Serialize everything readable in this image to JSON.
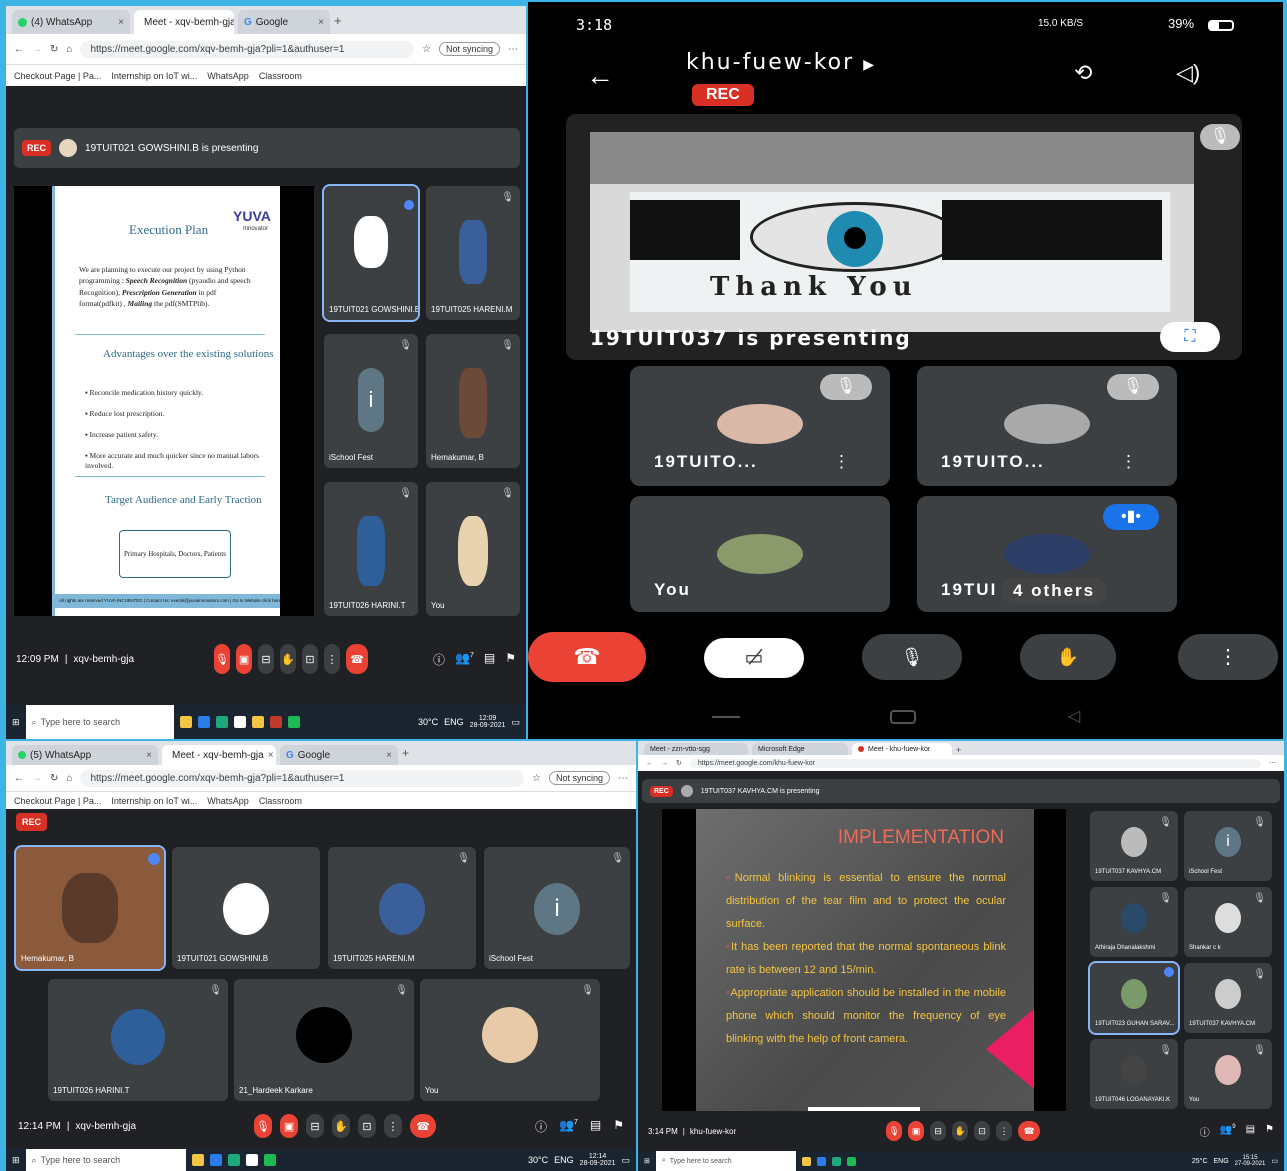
{
  "q1": {
    "tabs": [
      {
        "label": "(4) WhatsApp"
      },
      {
        "label": "Meet - xqv-bemh-gja"
      },
      {
        "label": "Google"
      }
    ],
    "new_tab": "+",
    "url": "https://meet.google.com/xqv-bemh-gja?pli=1&authuser=1",
    "sync": "Not syncing",
    "bookmarks": [
      "Checkout Page | Pa...",
      "Internship on IoT wi...",
      "WhatsApp",
      "Classroom"
    ],
    "rec": "REC",
    "presenting": "19TUIT021 GOWSHINI.B is presenting",
    "slide": {
      "title1": "Execution Plan",
      "logo": "YUVA",
      "logo_sub": "Innovator",
      "para_a": "We are planning to execute our project by using Python programming : ",
      "para_b": "Speech Recognition",
      "para_c": " (pyaudio and speech Recognition), ",
      "para_d": "Prescription Generation",
      "para_e": " in pdf format(pdfkit) , ",
      "para_f": "Mailing",
      "para_g": " the pdf(SMTPlib).",
      "title2": "Advantages over the existing solutions",
      "bullets": [
        "Reconcile medication history quickly.",
        "Reduce lost prescription.",
        "Increase patient safety.",
        "More accurate and much quicker since no manual labors involved."
      ],
      "title3": "Target Audience and Early Traction",
      "box": "Primary Hospitals, Doctors, Patients",
      "footer": "All rights are reserved YUVA INCUBATED | Contact Us: events@yuvainnovators.com | Go to Website click here"
    },
    "tiles": [
      {
        "name": "19TUIT021 GOWSHINI.B"
      },
      {
        "name": "19TUIT025 HARENI.M"
      },
      {
        "name": "iSchool Fest",
        "initial": "i"
      },
      {
        "name": "Hemakumar, B"
      },
      {
        "name": "19TUIT026 HARINI.T"
      },
      {
        "name": "You"
      }
    ],
    "time": "12:09 PM",
    "code": "xqv-bemh-gja",
    "people": "7",
    "search": "Type here to search",
    "weather": "30°C",
    "lang": "ENG",
    "clock": "12:09",
    "date": "28-09-2021"
  },
  "q2": {
    "time": "3:18",
    "status": "39%",
    "net": "15.0 KB/S",
    "room": "khu-fuew-kor",
    "rec": "REC",
    "shared_text": "Thank You",
    "presenting": "19TUIT037 is presenting",
    "tiles": [
      {
        "name": "19TUITO..."
      },
      {
        "name": "19TUITO..."
      },
      {
        "name": "You"
      },
      {
        "name": "19TUI",
        "extra": "4 others"
      }
    ]
  },
  "q3": {
    "tabs": [
      {
        "label": "(5) WhatsApp"
      },
      {
        "label": "Meet - xqv-bemh-gja"
      },
      {
        "label": "Google"
      }
    ],
    "new_tab": "+",
    "url": "https://meet.google.com/xqv-bemh-gja?pli=1&authuser=1",
    "sync": "Not syncing",
    "bookmarks": [
      "Checkout Page | Pa...",
      "Internship on IoT wi...",
      "WhatsApp",
      "Classroom"
    ],
    "rec": "REC",
    "tiles": [
      {
        "name": "Hemakumar, B"
      },
      {
        "name": "19TUIT021 GOWSHINI.B"
      },
      {
        "name": "19TUIT025 HARENI.M"
      },
      {
        "name": "iSchool Fest",
        "initial": "i"
      },
      {
        "name": "19TUIT026 HARINI.T"
      },
      {
        "name": "21_Hardeek Karkare"
      },
      {
        "name": "You"
      }
    ],
    "time": "12:14 PM",
    "code": "xqv-bemh-gja",
    "people": "7",
    "search": "Type here to search",
    "weather": "30°C",
    "lang": "ENG",
    "clock": "12:14",
    "date": "28-09-2021"
  },
  "q4": {
    "tabs": [
      {
        "label": "Meet - zzn-vtto-sgg"
      },
      {
        "label": "Microsoft Edge"
      },
      {
        "label": "Meet - khu-fuew-kor"
      }
    ],
    "new_tab": "+",
    "url": "https://meet.google.com/khu-fuew-kor",
    "rec": "REC",
    "presenting": "19TUIT037 KAVHYA.CM is presenting",
    "slide": {
      "title": "IMPLEMENTATION",
      "p1": "Normal blinking is essential to ensure the normal distribution of the tear film and to protect the ocular surface.",
      "p2": "It has been reported that the normal spontaneous blink rate is between 12 and 15/min.",
      "p3": "Appropriate application should be installed in the mobile phone which should monitor the frequency of eye blinking with the help of front camera."
    },
    "tiles": [
      {
        "name": "19TUIT037 KAVHYA.CM"
      },
      {
        "name": "iSchool Fest",
        "initial": "i"
      },
      {
        "name": "Athiraja Dhanalakshmi"
      },
      {
        "name": "Shankar c k"
      },
      {
        "name": "19TUIT023 GUHAN SARAV..."
      },
      {
        "name": "19TUIT037 KAVHYA.CM"
      },
      {
        "name": "19TUIT046 LOGANAYAKI.K"
      },
      {
        "name": "You"
      }
    ],
    "time": "3:14 PM",
    "code": "khu-fuew-kor",
    "people": "9",
    "search": "Type here to search",
    "weather": "25°C",
    "lang": "ENG",
    "clock": "15:15",
    "date": "27-09-2021"
  }
}
